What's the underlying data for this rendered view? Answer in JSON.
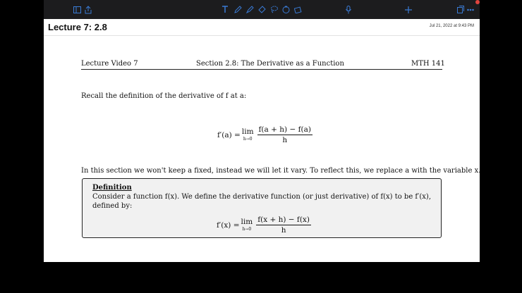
{
  "toolbar": {
    "icons": [
      "sidebar-icon",
      "share-icon",
      "text-tool-icon",
      "pen-icon",
      "highlighter-icon",
      "eraser-icon",
      "lasso-icon",
      "shapes-icon",
      "image-icon",
      "microphone-icon",
      "add-icon",
      "pages-icon",
      "more-icon"
    ]
  },
  "document": {
    "title": "Lecture 7: 2.8",
    "date": "Jul 21, 2022 at 9:43 PM"
  },
  "page": {
    "header_left": "Lecture Video 7",
    "header_center": "Section 2.8: The Derivative as a Function",
    "header_right": "MTH 141",
    "recall_text": "Recall the definition of the derivative of f at a:",
    "formula1_lhs": "f′(a) =",
    "formula1_lim": "lim",
    "formula1_sub": "h→0",
    "formula1_num": "f(a + h) − f(a)",
    "formula1_den": "h",
    "section_text": "In this section we won't keep a fixed, instead we will let it vary. To reflect this, we replace a with the variable x.",
    "definition": {
      "heading": "Definition",
      "text": "Consider a function f(x). We define the derivative function (or just derivative) of f(x) to be f′(x), defined by:",
      "formula_lhs": "f′(x) =",
      "formula_lim": "lim",
      "formula_sub": "h→0",
      "formula_num": "f(x + h) − f(x)",
      "formula_den": "h"
    }
  }
}
